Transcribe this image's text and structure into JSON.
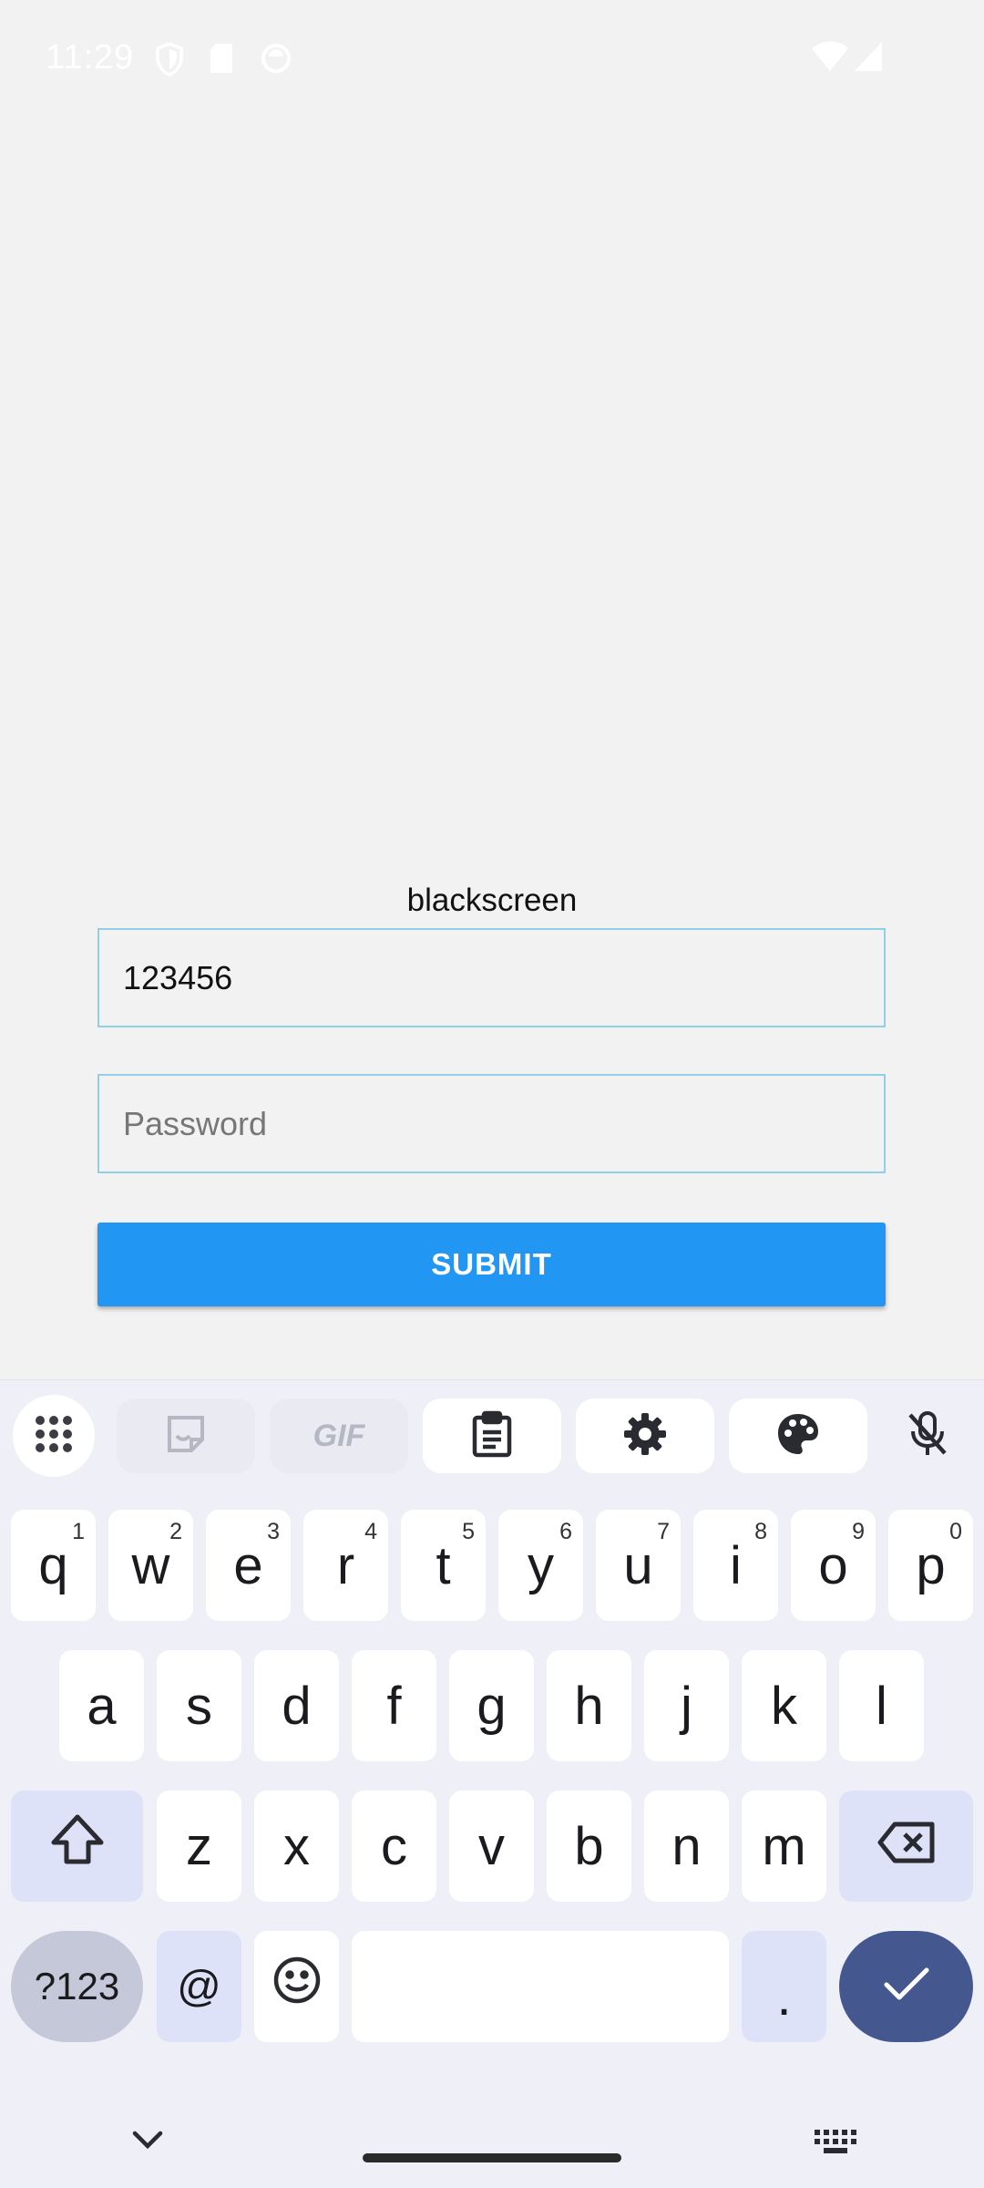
{
  "status_bar": {
    "time": "11:29",
    "left_icons": [
      "shield-icon",
      "sd-card-icon",
      "circle-status-icon"
    ],
    "right_icons": [
      "wifi-icon",
      "cellular-signal-icon"
    ],
    "color": "#ffffff"
  },
  "form": {
    "title": "blackscreen",
    "username_value": "123456",
    "password_placeholder": "Password",
    "submit_label": "SUBMIT",
    "accent_color": "#2196f3",
    "field_border_color": "#8fd0e8"
  },
  "keyboard": {
    "toolbar_icons": [
      "apps-grid-icon",
      "sticker-icon",
      "gif-icon",
      "clipboard-icon",
      "settings-gear-icon",
      "palette-icon",
      "mic-off-icon"
    ],
    "gif_label": "GIF",
    "row1": [
      {
        "key": "q",
        "hint": "1"
      },
      {
        "key": "w",
        "hint": "2"
      },
      {
        "key": "e",
        "hint": "3"
      },
      {
        "key": "r",
        "hint": "4"
      },
      {
        "key": "t",
        "hint": "5"
      },
      {
        "key": "y",
        "hint": "6"
      },
      {
        "key": "u",
        "hint": "7"
      },
      {
        "key": "i",
        "hint": "8"
      },
      {
        "key": "o",
        "hint": "9"
      },
      {
        "key": "p",
        "hint": "0"
      }
    ],
    "row2": [
      "a",
      "s",
      "d",
      "f",
      "g",
      "h",
      "j",
      "k",
      "l"
    ],
    "row3": [
      "z",
      "x",
      "c",
      "v",
      "b",
      "n",
      "m"
    ],
    "symbols_label": "?123",
    "at_label": "@",
    "period_label": ".",
    "enter_color": "#45578f",
    "modifier_color": "#dee2f8"
  }
}
